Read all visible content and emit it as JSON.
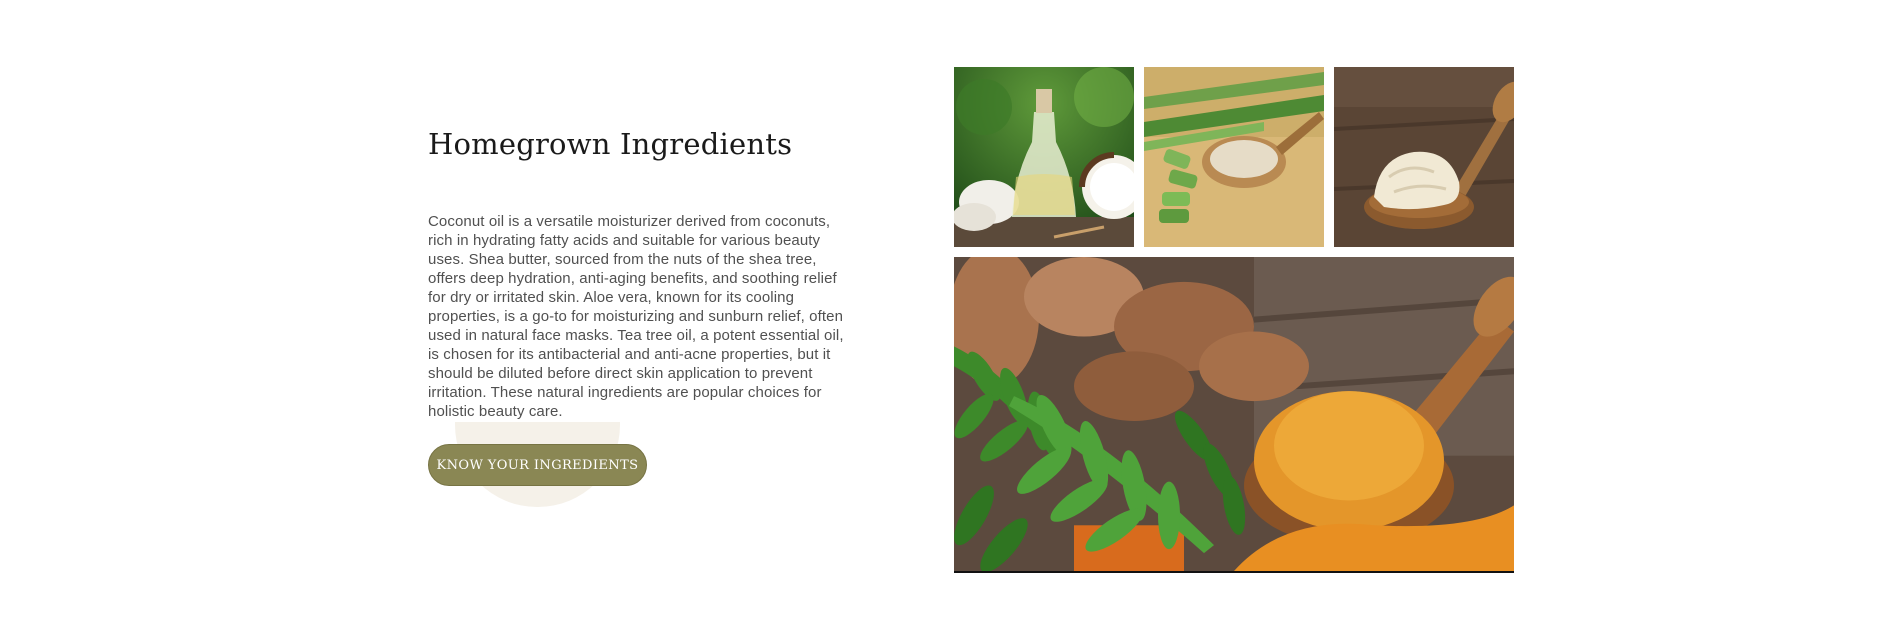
{
  "section": {
    "title": "Homegrown Ingredients",
    "description": "Coconut oil is a versatile moisturizer derived from coconuts, rich in hydrating fatty acids and suitable for various beauty uses. Shea butter, sourced from the nuts of the shea tree, offers deep hydration, anti-aging benefits, and soothing relief for dry or irritated skin. Aloe vera, known for its cooling properties, is a go-to for moisturizing and sunburn relief, often used in natural face masks. Tea tree oil, a potent essential oil, is chosen for its antibacterial and anti-acne properties, but it should be diluted before direct skin application to prevent irritation. These natural ingredients are popular choices for holistic beauty care.",
    "cta_label": "KNOW YOUR INGREDIENTS"
  },
  "gallery": {
    "images": [
      {
        "subject": "coconut-oil-bottle"
      },
      {
        "subject": "aloe-vera-gel"
      },
      {
        "subject": "shea-butter-spoon"
      },
      {
        "subject": "turmeric-neem"
      }
    ]
  },
  "colors": {
    "cta_background": "#8a8754",
    "blob": "#f5f1e9",
    "title": "#1a1a1a",
    "body_text": "#505050"
  }
}
